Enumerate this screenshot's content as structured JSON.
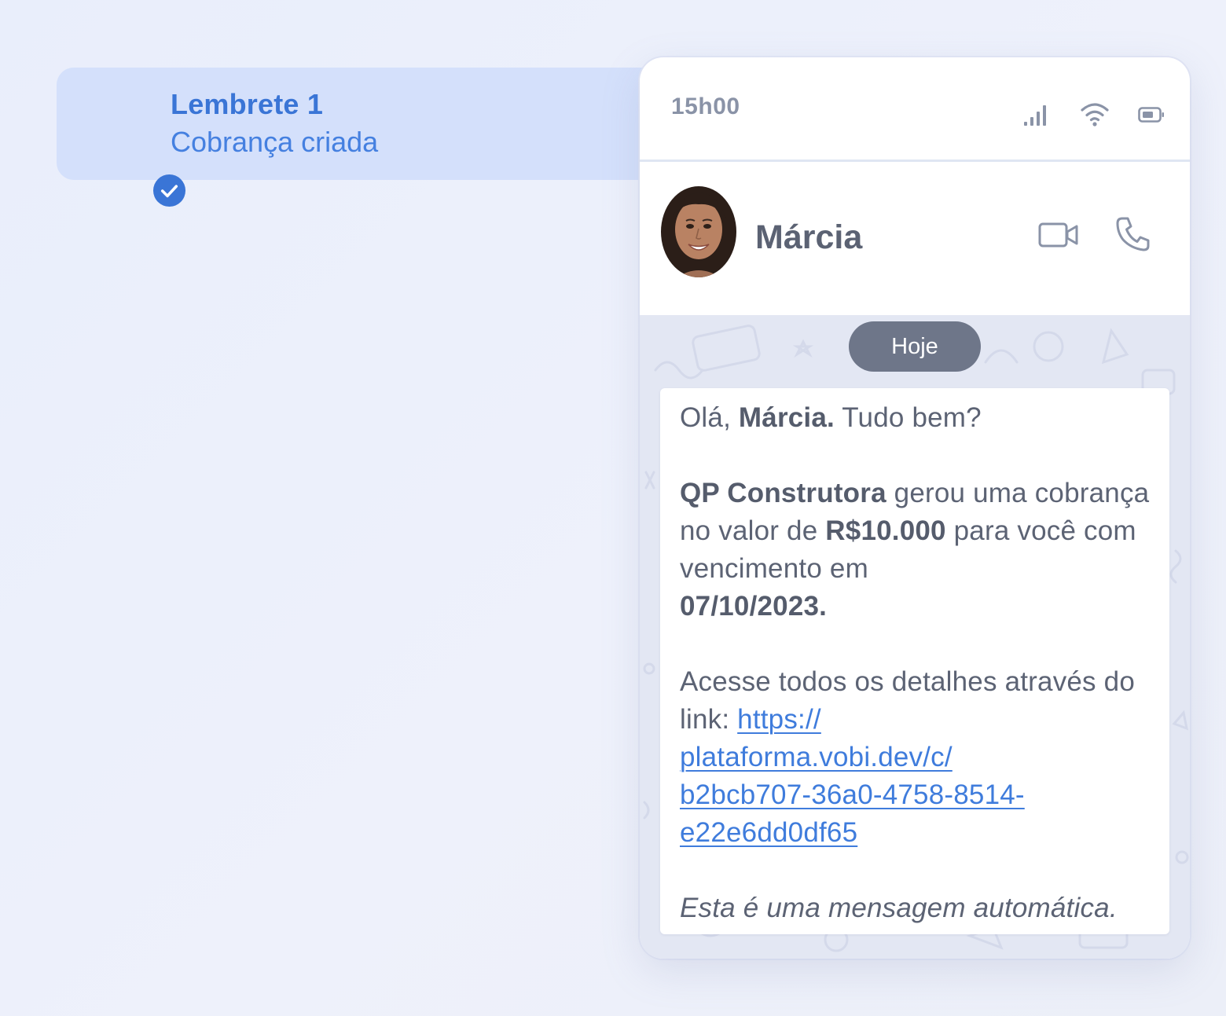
{
  "reminder": {
    "title": "Lembrete 1",
    "subtitle": "Cobrança criada",
    "icon": "check-circle-icon",
    "accent_color": "#3a75d6",
    "background_color": "#d4e0fb"
  },
  "phone": {
    "status_bar": {
      "time": "15h00",
      "icons": [
        "signal-icon",
        "wifi-icon",
        "battery-icon"
      ]
    },
    "chat_header": {
      "contact_name": "Márcia",
      "avatar": "avatar",
      "actions": [
        "video-call-icon",
        "phone-call-icon"
      ]
    },
    "chat": {
      "date_label": "Hoje",
      "message": {
        "greeting_prefix": "Olá, ",
        "greeting_name": "Márcia.",
        "greeting_suffix": " Tudo bem?",
        "company": "QP Construtora",
        "text_1": " gerou uma cobrança no valor de ",
        "amount": "R$10.000",
        "text_2": " para você com vencimento em ",
        "due_date": "07/10/2023.",
        "link_intro": "Acesse todos os detalhes através do link: ",
        "link_part_1": "https://",
        "link_part_2": "plataforma.vobi.dev/c/",
        "link_part_3": "b2bcb707-36a0-4758-8514-",
        "link_part_4": "e22e6dd0df65",
        "footer": "Esta é uma mensagem automática."
      }
    }
  }
}
